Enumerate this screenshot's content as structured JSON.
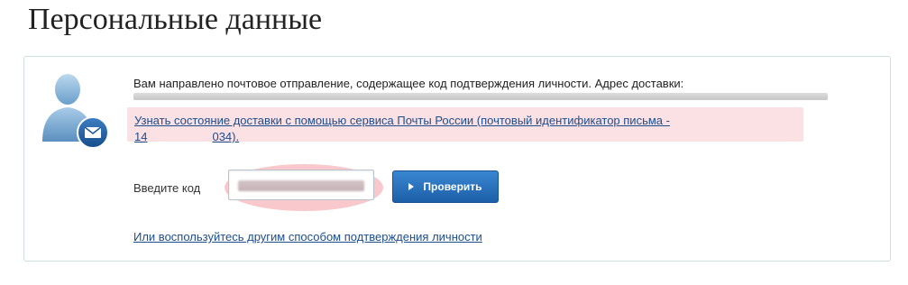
{
  "page": {
    "title": "Персональные данные"
  },
  "notice": {
    "message": "Вам направлено почтовое отправление, содержащее код подтверждения личности. Адрес доставки:",
    "tracking_link_line1": "Узнать состояние доставки с помощью сервиса Почты России (почтовый идентификатор письма -",
    "tracking_id_start": "14",
    "tracking_id_end": "034)."
  },
  "verify": {
    "code_label": "Введите код",
    "code_value": "",
    "check_button_label": "Проверить"
  },
  "alternative": {
    "link_text": "Или воспользуйтесь другим способом подтверждения личности"
  },
  "colors": {
    "link": "#1d4e8c",
    "button": "#2a72bf",
    "highlight": "#f8c8cc",
    "panel_border": "#cfdfe6"
  },
  "icons": {
    "avatar": "user-mail-icon",
    "button": "play-icon"
  }
}
